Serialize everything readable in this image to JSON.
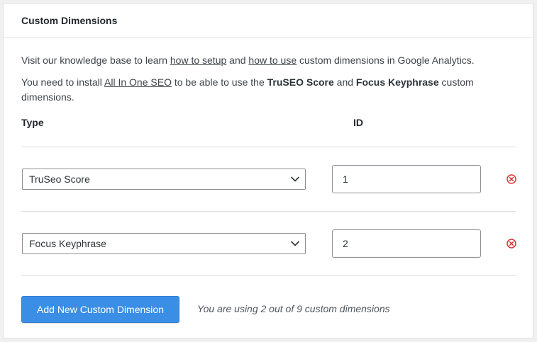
{
  "panel": {
    "title": "Custom Dimensions"
  },
  "intro": {
    "line1_prefix": "Visit our knowledge base to learn ",
    "link_setup": "how to setup",
    "line1_mid": " and ",
    "link_use": "how to use",
    "line1_suffix": " custom dimensions in Google Analytics.",
    "line2_prefix": "You need to install ",
    "link_aioseo": "All In One SEO",
    "line2_mid1": " to be able to use the ",
    "bold_truseo": "TruSEO Score",
    "line2_mid2": " and ",
    "bold_focus": "Focus Keyphrase",
    "line2_suffix": " custom dimensions."
  },
  "table": {
    "col_type": "Type",
    "col_id": "ID",
    "rows": [
      {
        "type": "TruSeo Score",
        "id": "1"
      },
      {
        "type": "Focus Keyphrase",
        "id": "2"
      }
    ]
  },
  "actions": {
    "add_label": "Add New Custom Dimension",
    "usage_text": "You are using 2 out of 9 custom dimensions"
  },
  "colors": {
    "accent": "#3a8ee6",
    "remove": "#d63638"
  },
  "icons": {
    "select_arrow": "chevron-down-icon",
    "remove": "remove-circle-x-icon"
  }
}
